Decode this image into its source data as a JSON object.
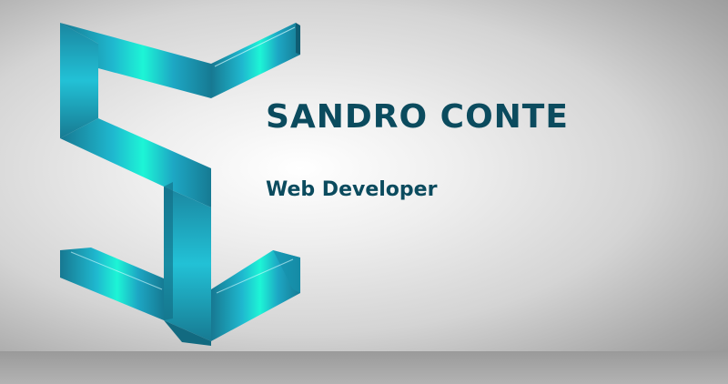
{
  "banner": {
    "name": "SANDRO CONTE",
    "role": "Web Developer",
    "logo": "sc-monogram-logo"
  },
  "colors": {
    "text": "#0b4b5e",
    "logo_dark": "#1a7f9a",
    "logo_mid": "#22aecb",
    "logo_highlight": "#1df5d6"
  }
}
